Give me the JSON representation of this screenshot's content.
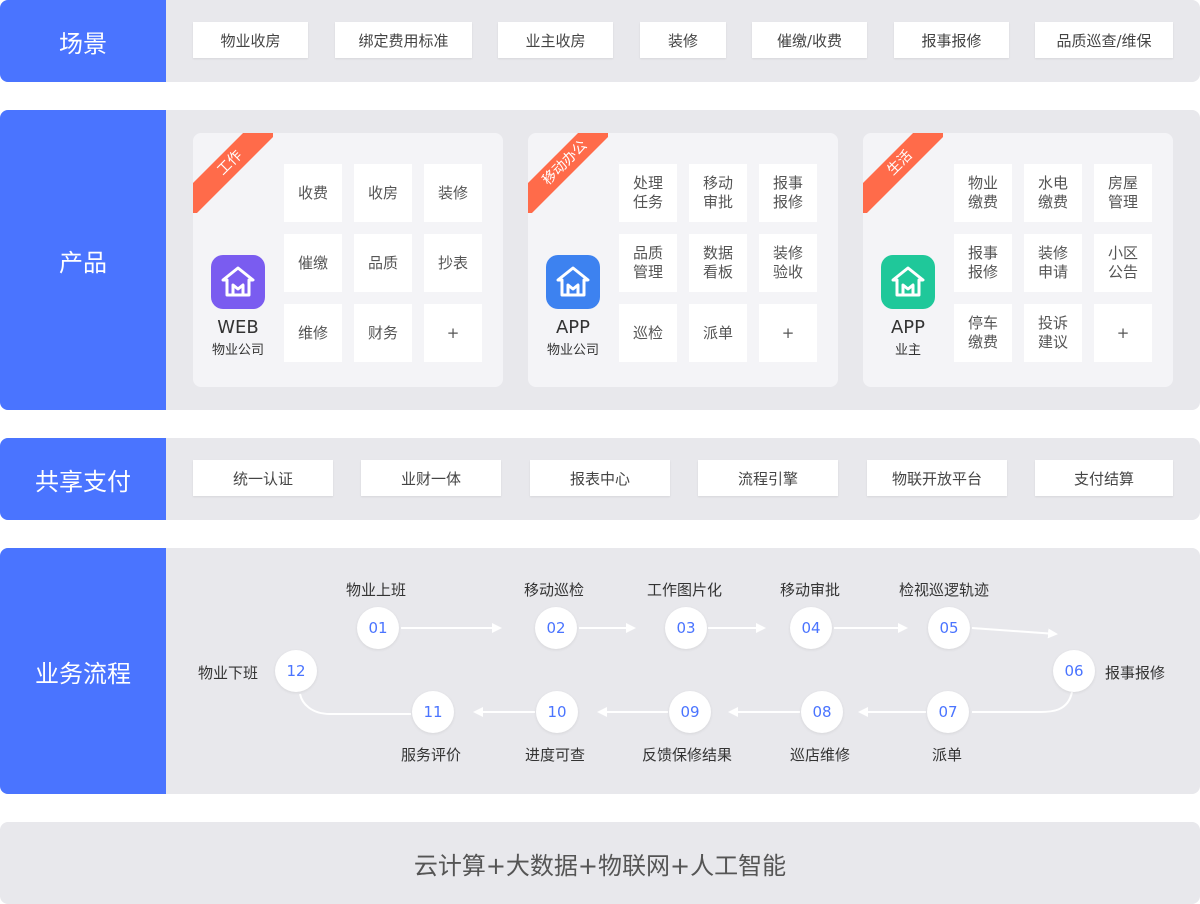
{
  "scene": {
    "label": "场景",
    "tags": [
      "物业收房",
      "绑定费用标准",
      "业主收房",
      "装修",
      "催缴/收费",
      "报事报修",
      "品质巡查/维保"
    ]
  },
  "product": {
    "label": "产品",
    "cards": [
      {
        "ribbon": "工作",
        "app_name": "WEB",
        "app_sub": "物业公司",
        "icon_color": "#7a5cf0",
        "modules": [
          "收费",
          "收房",
          "装修",
          "催缴",
          "品质",
          "抄表",
          "维修",
          "财务",
          "+"
        ]
      },
      {
        "ribbon": "移动办公",
        "app_name": "APP",
        "app_sub": "物业公司",
        "icon_color": "#3d82f0",
        "modules": [
          "处理\n任务",
          "移动\n审批",
          "报事\n报修",
          "品质\n管理",
          "数据\n看板",
          "装修\n验收",
          "巡检",
          "派单",
          "+"
        ]
      },
      {
        "ribbon": "生活",
        "app_name": "APP",
        "app_sub": "业主",
        "icon_color": "#1fc89a",
        "modules": [
          "物业\n缴费",
          "水电\n缴费",
          "房屋\n管理",
          "报事\n报修",
          "装修\n申请",
          "小区\n公告",
          "停车\n缴费",
          "投诉\n建议",
          "+"
        ]
      }
    ]
  },
  "shared": {
    "label": "共享支付",
    "tags": [
      "统一认证",
      "业财一体",
      "报表中心",
      "流程引擎",
      "物联开放平台",
      "支付结算"
    ]
  },
  "process": {
    "label": "业务流程",
    "steps": [
      {
        "num": "01",
        "label": "物业上班"
      },
      {
        "num": "02",
        "label": "移动巡检"
      },
      {
        "num": "03",
        "label": "工作图片化"
      },
      {
        "num": "04",
        "label": "移动审批"
      },
      {
        "num": "05",
        "label": "检视巡逻轨迹"
      },
      {
        "num": "06",
        "label": "报事报修"
      },
      {
        "num": "07",
        "label": "派单"
      },
      {
        "num": "08",
        "label": "巡店维修"
      },
      {
        "num": "09",
        "label": "反馈保修结果"
      },
      {
        "num": "10",
        "label": "进度可查"
      },
      {
        "num": "11",
        "label": "服务评价"
      },
      {
        "num": "12",
        "label": "物业下班"
      }
    ]
  },
  "base": {
    "text": "云计算+大数据+物联网+人工智能"
  },
  "colors": {
    "accent": "#4a74ff",
    "ribbon": "#ff6b4a",
    "row_bg": "#e8e8ec"
  }
}
